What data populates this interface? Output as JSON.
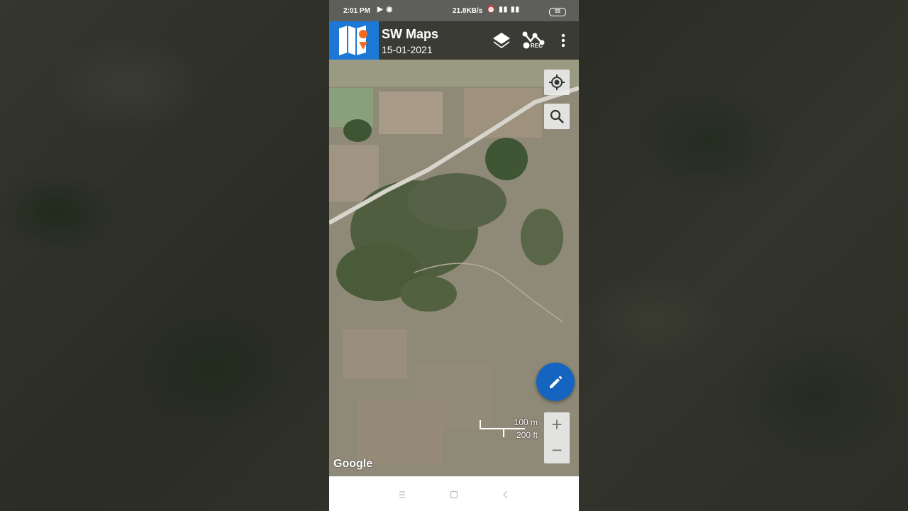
{
  "status_bar": {
    "time": "2:01 PM",
    "left_icons": "▶ ◉",
    "network_speed": "21.8KB/s",
    "right_icons": "⏰ ▮▮ ▮▮",
    "battery": "55"
  },
  "app_bar": {
    "title": "SW Maps",
    "date": "15-01-2021",
    "rec_label": "REC",
    "icons": [
      "map-logo-icon",
      "layers-icon",
      "rec-track-icon",
      "more-vert-icon"
    ]
  },
  "map": {
    "scale_metric": "100 m",
    "scale_imperial": "200 ft",
    "attribution": "Google",
    "zoom_in_label": "+",
    "zoom_out_label": "−",
    "controls": [
      "my-location-icon",
      "search-icon",
      "edit-icon"
    ]
  },
  "nav_bar": {
    "icons": [
      "menu-icon",
      "home-icon",
      "back-icon"
    ]
  },
  "colors": {
    "app_bar": "#3a3b35",
    "logo_bg": "#1c78d4",
    "fab": "#1565c0",
    "status_bar": "#5e5f5a"
  }
}
